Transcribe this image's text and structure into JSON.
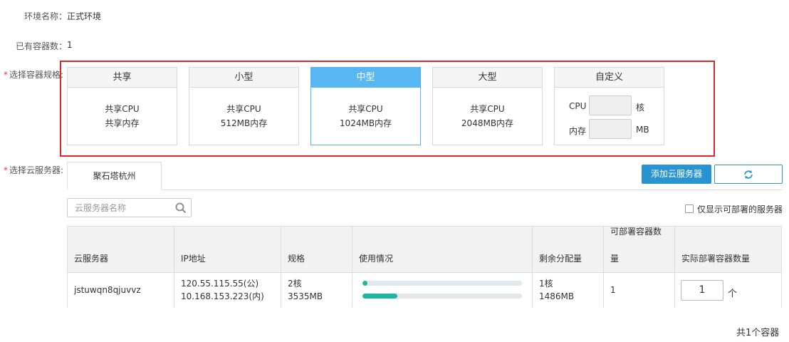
{
  "env": {
    "label": "环境名称：",
    "value": "正式环境"
  },
  "container_count": {
    "label": "已有容器数：",
    "value": "1"
  },
  "spec": {
    "label": "选择容器规格:",
    "required_mark": "*",
    "cards": [
      {
        "title": "共享",
        "line1": "共享CPU",
        "line2": "共享内存",
        "selected": false
      },
      {
        "title": "小型",
        "line1": "共享CPU",
        "line2": "512MB内存",
        "selected": false
      },
      {
        "title": "中型",
        "line1": "共享CPU",
        "line2": "1024MB内存",
        "selected": true
      },
      {
        "title": "大型",
        "line1": "共享CPU",
        "line2": "2048MB内存",
        "selected": false
      }
    ],
    "custom": {
      "title": "自定义",
      "cpu_label": "CPU",
      "cpu_unit": "核",
      "cpu_value": "",
      "mem_label": "内存",
      "mem_unit": "MB",
      "mem_value": ""
    },
    "accent_color": "#58b7f3",
    "highlight_color": "#d9272e"
  },
  "server": {
    "label": "选择云服务器:",
    "required_mark": "*",
    "tab": "聚石塔杭州",
    "add_button": "添加云服务器",
    "refresh_icon": "refresh-icon",
    "search_placeholder": "云服务器名称",
    "search_icon": "search-icon",
    "filter_label": "仅显示可部署的服务器",
    "filter_checked": false,
    "primary_color": "#2a93d1"
  },
  "table": {
    "headers": {
      "server": "云服务器",
      "ip": "IP地址",
      "spec": "规格",
      "usage": "使用情况",
      "remaining": "剩余分配量",
      "deployable_line1": "可部署容器数",
      "deployable_line2": "量",
      "actual": "实际部署容器数量"
    },
    "rows": [
      {
        "server": "jstuwqn8qjuvvz",
        "ip_public": "120.55.115.55(公)",
        "ip_private": "10.168.153.223(内)",
        "spec_cpu": "2核",
        "spec_mem": "3535MB",
        "usage_cpu_fraction": 0.03,
        "usage_mem_fraction": 0.22,
        "remaining_cpu": "1核",
        "remaining_mem": "1486MB",
        "deployable": "1",
        "actual_value": "1",
        "actual_unit": "个"
      }
    ],
    "usage_color": "#1fb5a0"
  },
  "footer": {
    "total": "共1个容器"
  }
}
